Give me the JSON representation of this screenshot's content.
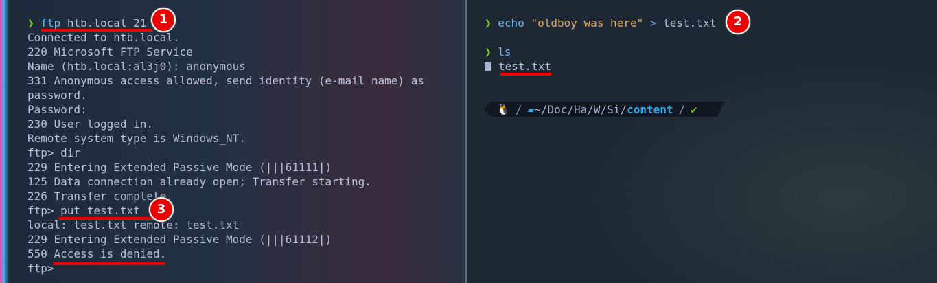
{
  "left_pane": {
    "prompt_symbol": "❯",
    "command": "ftp",
    "command_args": " htb.local 21",
    "output": [
      "Connected to htb.local.",
      "220 Microsoft FTP Service",
      "Name (htb.local:al3j0): anonymous",
      "331 Anonymous access allowed, send identity (e-mail name) as",
      "password.",
      "Password:",
      "230 User logged in.",
      "Remote system type is Windows_NT.",
      "ftp> dir",
      "229 Entering Extended Passive Mode (|||61111|)",
      "125 Data connection already open; Transfer starting.",
      "226 Transfer complete.",
      "ftp> put test.txt",
      "local: test.txt remote: test.txt",
      "229 Entering Extended Passive Mode (|||61112|)",
      "550 Access is denied.",
      "ftp>"
    ]
  },
  "right_pane": {
    "prompt_symbol": "❯",
    "echo_cmd": "echo",
    "echo_string": "\"oldboy was here\"",
    "redirect": ">",
    "echo_target": "test.txt",
    "ls_cmd": "ls",
    "ls_result": "test.txt",
    "status_bar": {
      "os_icon": "linux-tux-icon",
      "path_prefix": "~/Doc/Ha/W/Si/",
      "path_current": "content",
      "status": "✔"
    }
  },
  "annotations": [
    "1",
    "2",
    "3"
  ],
  "colors": {
    "annotation": "#e90000",
    "prompt": "#7bd21a",
    "command": "#6fb8e8",
    "string": "#d9a95e"
  }
}
